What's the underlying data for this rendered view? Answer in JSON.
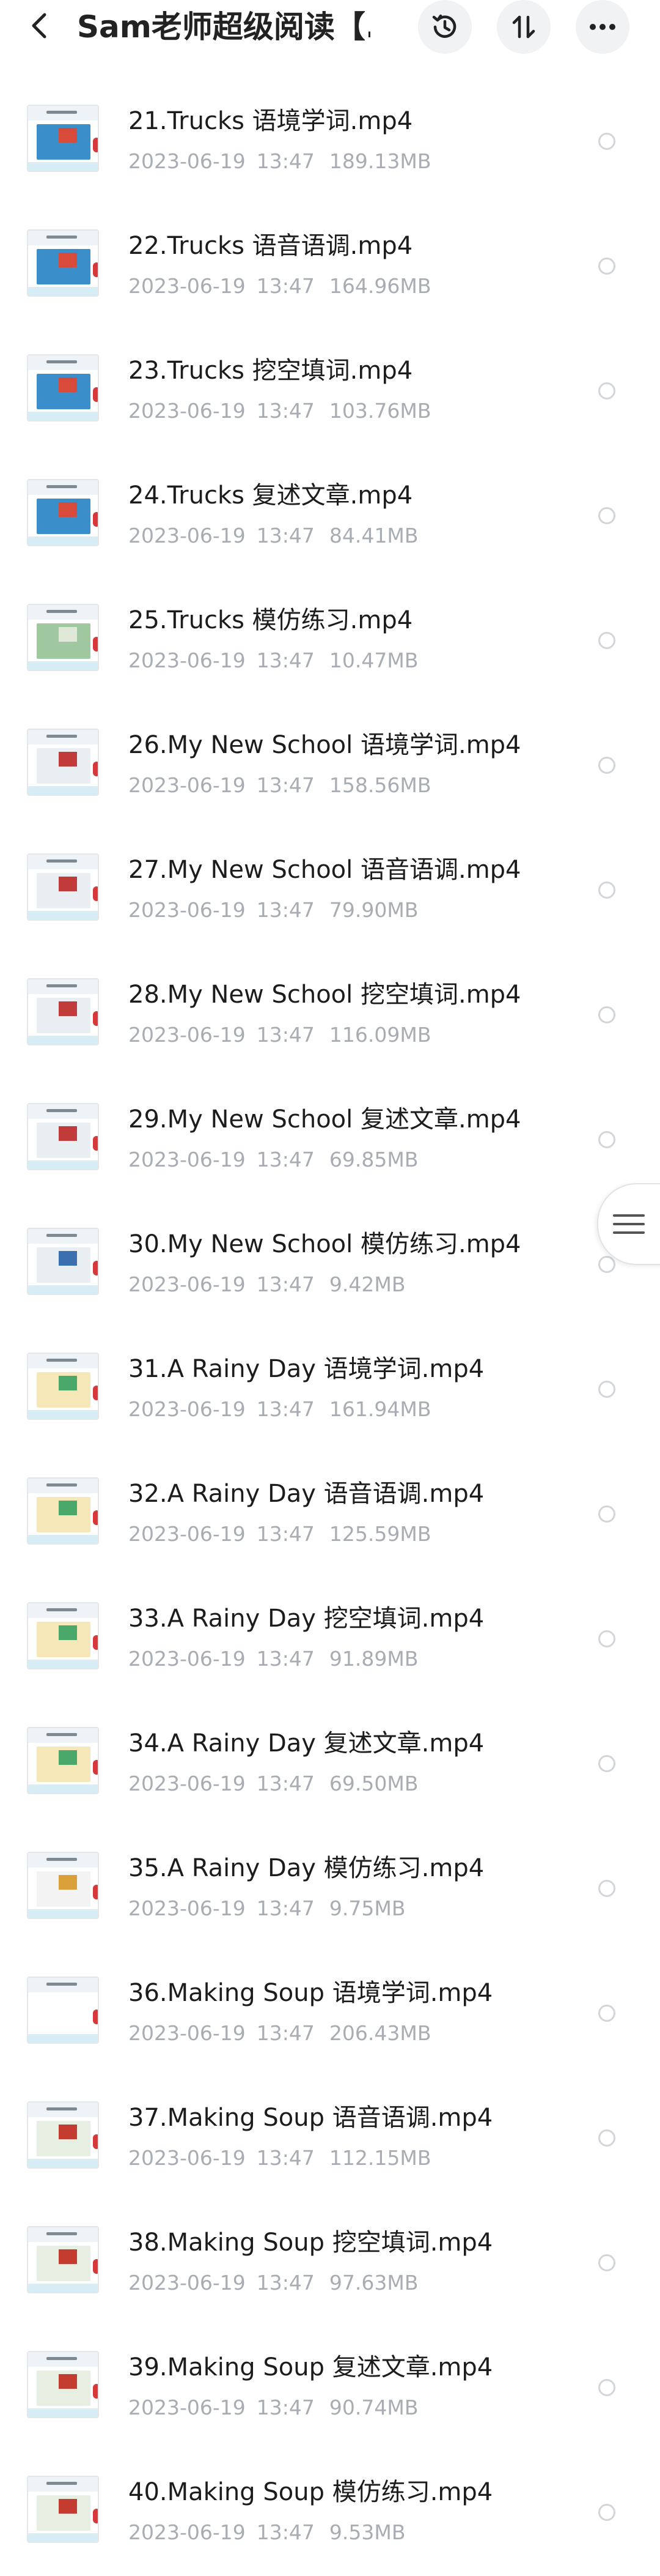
{
  "header": {
    "title": "Sam老师超级阅读【...",
    "back_icon": "chevron-left-icon",
    "history_icon": "history-icon",
    "sort_icon": "sort-icon",
    "more_icon": "more-dots-icon"
  },
  "files": [
    {
      "name": "21.Trucks 语境学词.mp4",
      "date": "2023-06-19",
      "time": "13:47",
      "size": "189.13MB",
      "thumb": "trucks"
    },
    {
      "name": "22.Trucks 语音语调.mp4",
      "date": "2023-06-19",
      "time": "13:47",
      "size": "164.96MB",
      "thumb": "trucks"
    },
    {
      "name": "23.Trucks 挖空填词.mp4",
      "date": "2023-06-19",
      "time": "13:47",
      "size": "103.76MB",
      "thumb": "trucks"
    },
    {
      "name": "24.Trucks 复述文章.mp4",
      "date": "2023-06-19",
      "time": "13:47",
      "size": "84.41MB",
      "thumb": "trucks"
    },
    {
      "name": "25.Trucks 模仿练习.mp4",
      "date": "2023-06-19",
      "time": "13:47",
      "size": "10.47MB",
      "thumb": "trucks2"
    },
    {
      "name": "26.My New School 语境学词.mp4",
      "date": "2023-06-19",
      "time": "13:47",
      "size": "158.56MB",
      "thumb": "school"
    },
    {
      "name": "27.My New School 语音语调.mp4",
      "date": "2023-06-19",
      "time": "13:47",
      "size": "79.90MB",
      "thumb": "school"
    },
    {
      "name": "28.My New School 挖空填词.mp4",
      "date": "2023-06-19",
      "time": "13:47",
      "size": "116.09MB",
      "thumb": "school"
    },
    {
      "name": "29.My New School 复述文章.mp4",
      "date": "2023-06-19",
      "time": "13:47",
      "size": "69.85MB",
      "thumb": "school"
    },
    {
      "name": "30.My New School 模仿练习.mp4",
      "date": "2023-06-19",
      "time": "13:47",
      "size": "9.42MB",
      "thumb": "school2"
    },
    {
      "name": "31.A Rainy Day 语境学词.mp4",
      "date": "2023-06-19",
      "time": "13:47",
      "size": "161.94MB",
      "thumb": "rainy"
    },
    {
      "name": "32.A Rainy Day 语音语调.mp4",
      "date": "2023-06-19",
      "time": "13:47",
      "size": "125.59MB",
      "thumb": "rainy"
    },
    {
      "name": "33.A Rainy Day 挖空填词.mp4",
      "date": "2023-06-19",
      "time": "13:47",
      "size": "91.89MB",
      "thumb": "rainy"
    },
    {
      "name": "34.A Rainy Day 复述文章.mp4",
      "date": "2023-06-19",
      "time": "13:47",
      "size": "69.50MB",
      "thumb": "rainy"
    },
    {
      "name": "35.A Rainy Day 模仿练习.mp4",
      "date": "2023-06-19",
      "time": "13:47",
      "size": "9.75MB",
      "thumb": "rainy2"
    },
    {
      "name": "36.Making Soup 语境学词.mp4",
      "date": "2023-06-19",
      "time": "13:47",
      "size": "206.43MB",
      "thumb": "blank"
    },
    {
      "name": "37.Making Soup 语音语调.mp4",
      "date": "2023-06-19",
      "time": "13:47",
      "size": "112.15MB",
      "thumb": "soup"
    },
    {
      "name": "38.Making Soup 挖空填词.mp4",
      "date": "2023-06-19",
      "time": "13:47",
      "size": "97.63MB",
      "thumb": "soup"
    },
    {
      "name": "39.Making Soup 复述文章.mp4",
      "date": "2023-06-19",
      "time": "13:47",
      "size": "90.74MB",
      "thumb": "soup"
    },
    {
      "name": "40.Making Soup 模仿练习.mp4",
      "date": "2023-06-19",
      "time": "13:47",
      "size": "9.53MB",
      "thumb": "soup"
    }
  ],
  "side_handle_icon": "menu-lines-icon",
  "colors": {
    "text_primary": "#1c1c1c",
    "text_secondary": "#a8adb4",
    "header_button_bg": "#f1f2f4",
    "radio_border": "#d2d5d9"
  }
}
